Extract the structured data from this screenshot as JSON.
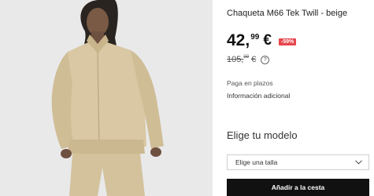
{
  "product": {
    "title": "Chaqueta M66 Tek Twill - beige",
    "image_alt": "Chaqueta M66 Tek Twill beige",
    "price": {
      "integer": "42,",
      "decimals": "99",
      "currency": "€"
    },
    "discount_badge": "-59%",
    "original_price": {
      "integer": "105,",
      "decimals": "00",
      "currency": "€"
    },
    "help_icon": "question-circle-icon"
  },
  "links": {
    "payment": "Paga en plazos",
    "additional_info": "Información adicional"
  },
  "model_section": {
    "heading": "Elige tu modelo",
    "size_select": "Elige una talla",
    "chevron_icon": "chevron-down-icon"
  },
  "actions": {
    "add_to_cart": "Añadir a la cesta"
  },
  "colors": {
    "discount_badge": "#e8454d",
    "button_bg": "#111111",
    "photo_bg": "#e9e9ea",
    "jacket": "#d9c8a3"
  }
}
